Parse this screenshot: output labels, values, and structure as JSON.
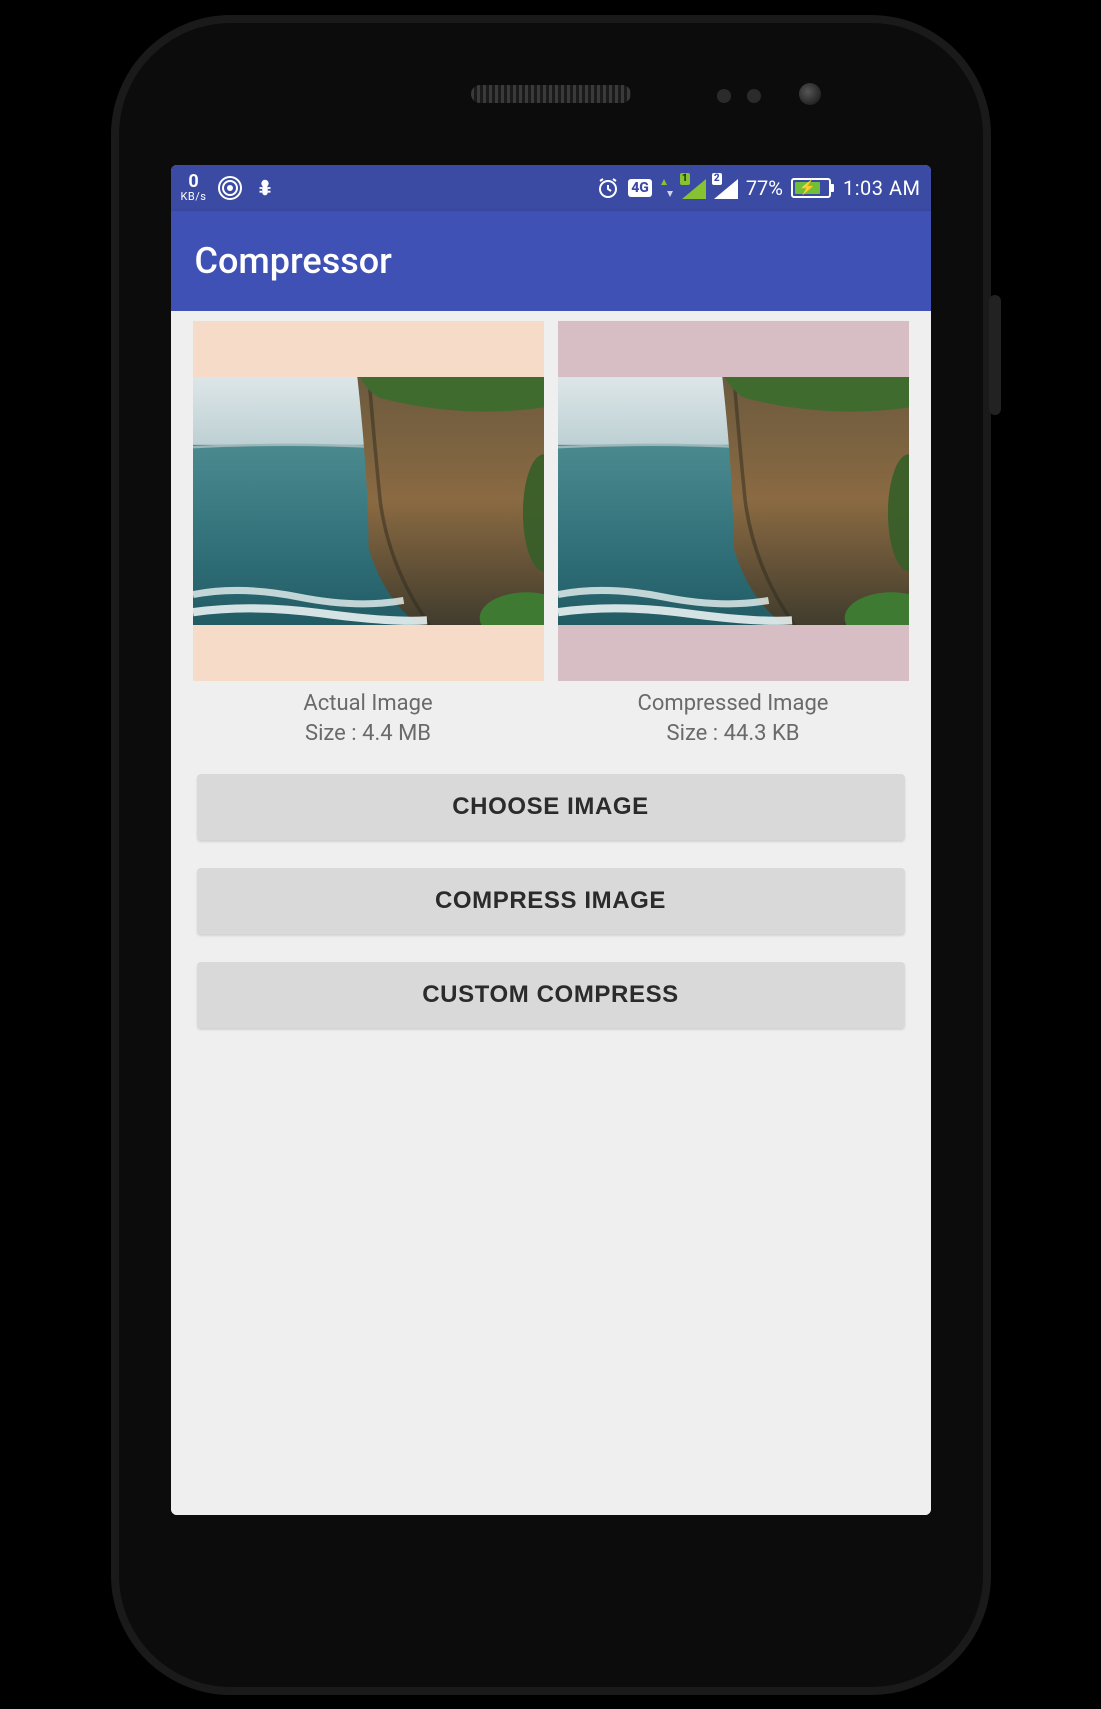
{
  "statusbar": {
    "kbs_value": "0",
    "kbs_label": "KB/s",
    "network_label": "4G",
    "sim1_index": "1",
    "sim2_index": "2",
    "battery_pct": "77%",
    "time": "1:03 AM"
  },
  "appbar": {
    "title": "Compressor"
  },
  "panels": {
    "left": {
      "title": "Actual Image",
      "size": "Size : 4.4 MB"
    },
    "right": {
      "title": "Compressed Image",
      "size": "Size : 44.3 KB"
    }
  },
  "buttons": {
    "choose": "CHOOSE IMAGE",
    "compress": "COMPRESS IMAGE",
    "custom": "CUSTOM COMPRESS"
  }
}
